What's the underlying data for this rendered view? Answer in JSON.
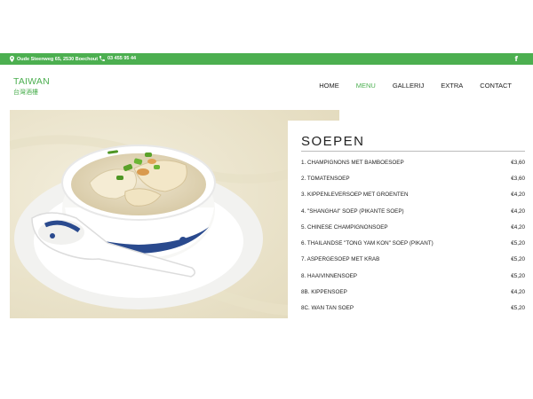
{
  "topbar": {
    "address": "Oude Steenweg 65, 2530 Boechout",
    "phone": "03 455 95 44",
    "social_icon": "facebook-icon",
    "social_label": "f",
    "color": "#4caf50"
  },
  "logo": {
    "name": "TAIWAN",
    "subtitle": "台灣酒樓"
  },
  "nav": {
    "items": [
      {
        "label": "HOME"
      },
      {
        "label": "MENU"
      },
      {
        "label": "GALLERIJ"
      },
      {
        "label": "EXTRA"
      },
      {
        "label": "CONTACT"
      }
    ],
    "active": "MENU"
  },
  "photo": {
    "description_icon": "soup-photo"
  },
  "menu": {
    "title": "SOEPEN",
    "items": [
      {
        "name": "1. CHAMPIGNONS MET BAMBOESOEP",
        "price": "€3,60"
      },
      {
        "name": "2. TOMATENSOEP",
        "price": "€3,60"
      },
      {
        "name": "3. KIPPENLEVERSOEP MET GROENTEN",
        "price": "€4,20"
      },
      {
        "name": "4. \"SHANGHAI\" SOEP (PIKANTE SOEP)",
        "price": "€4,20"
      },
      {
        "name": "5. CHINESE CHAMPIGNONSOEP",
        "price": "€4,20"
      },
      {
        "name": "6. THAILANDSE \"TONG YAM KON\" SOEP (PIKANT)",
        "price": "€5,20"
      },
      {
        "name": "7. ASPERGESOEP MET KRAB",
        "price": "€5,20"
      },
      {
        "name": "8. HAAIVINNENSOEP",
        "price": "€5,20"
      },
      {
        "name": "8B. KIPPENSOEP",
        "price": "€4,20"
      },
      {
        "name": "8C. WAN TAN SOEP",
        "price": "€5,20"
      }
    ]
  }
}
